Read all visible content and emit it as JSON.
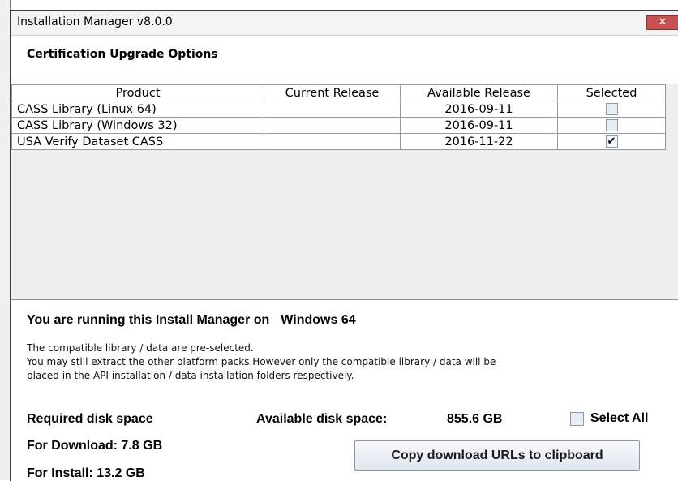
{
  "window": {
    "title": "Installation Manager v8.0.0",
    "close_glyph": "✕"
  },
  "heading": "Certification Upgrade Options",
  "table": {
    "columns": [
      "Product",
      "Current Release",
      "Available Release",
      "Selected"
    ],
    "rows": [
      {
        "product": "CASS Library (Linux 64)",
        "current": "",
        "available": "2016-09-11",
        "selected": false
      },
      {
        "product": "CASS Library (Windows 32)",
        "current": "",
        "available": "2016-09-11",
        "selected": false
      },
      {
        "product": "USA Verify Dataset CASS",
        "current": "",
        "available": "2016-11-22",
        "selected": true
      }
    ],
    "check_glyph": "✔"
  },
  "running": {
    "prefix": "You are running this Install Manager on",
    "os": "Windows 64"
  },
  "notes": [
    "The compatible library / data are pre-selected.",
    "You may still extract the other platform packs.However only the compatible library / data will be",
    "placed in the API installation / data installation folders respectively."
  ],
  "disk": {
    "required_label": "Required disk space",
    "available_label": "Available disk space:",
    "available_value": "855.6 GB",
    "download": "For Download: 7.8 GB",
    "install": "For Install: 13.2 GB"
  },
  "select_all_label": "Select All",
  "copy_button": "Copy download URLs to clipboard"
}
